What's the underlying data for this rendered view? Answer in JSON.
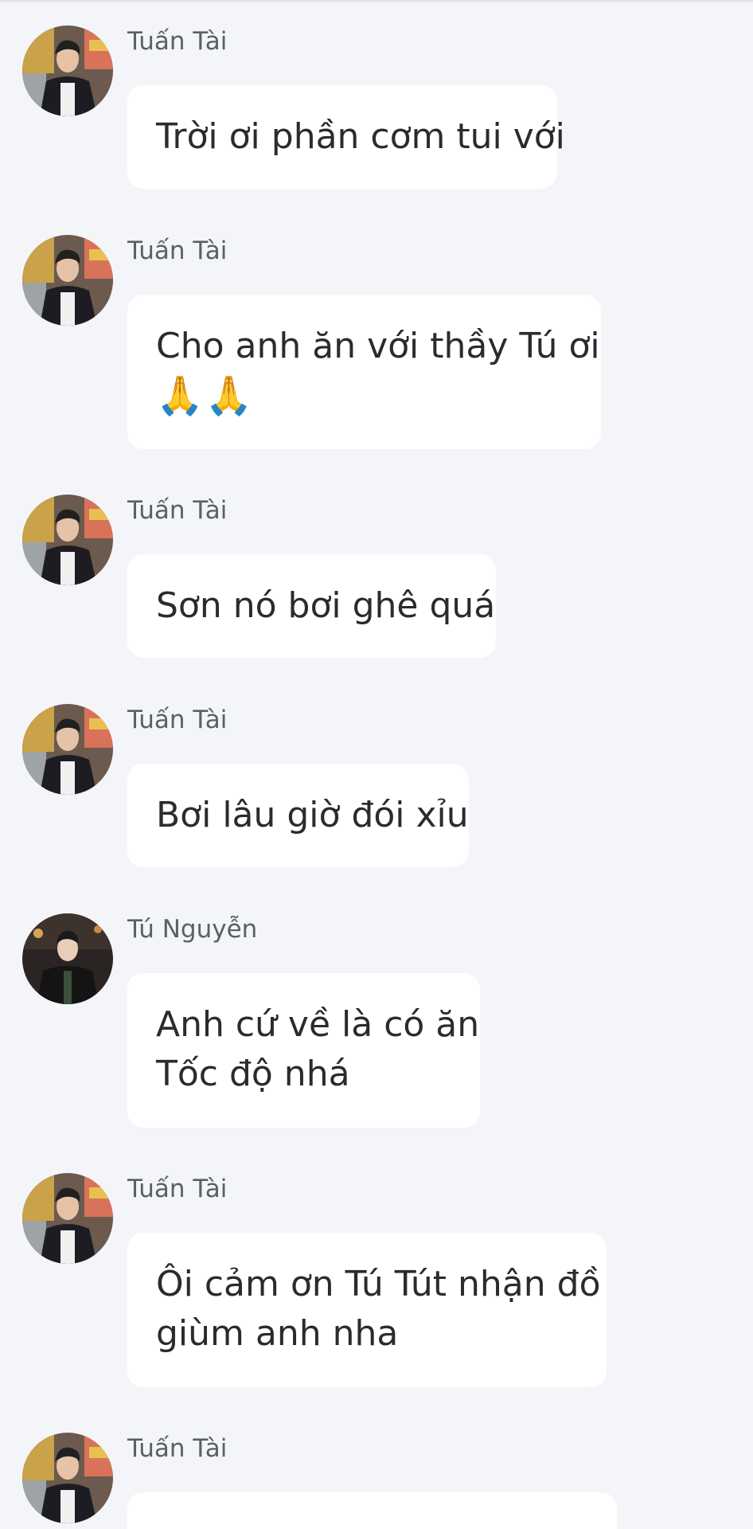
{
  "messages": [
    {
      "sender": "Tuấn Tài",
      "avatar": "tuan-tai",
      "lines": [
        "Trời ơi phần cơm tui với"
      ]
    },
    {
      "sender": "Tuấn Tài",
      "avatar": "tuan-tai",
      "lines": [
        "Cho anh ăn với thầy Tú ơi",
        "🙏🙏"
      ]
    },
    {
      "sender": "Tuấn Tài",
      "avatar": "tuan-tai",
      "lines": [
        "Sơn nó bơi ghê quá"
      ]
    },
    {
      "sender": "Tuấn Tài",
      "avatar": "tuan-tai",
      "lines": [
        "Bơi lâu giờ đói xỉu"
      ]
    },
    {
      "sender": "Tú Nguyễn",
      "avatar": "tu-nguyen",
      "lines": [
        "Anh cứ về là có ăn",
        "Tốc độ nhá"
      ]
    },
    {
      "sender": "Tuấn Tài",
      "avatar": "tuan-tai",
      "lines": [
        "Ôi cảm ơn Tú Tút nhận đồ",
        "giùm anh nha"
      ]
    },
    {
      "sender": "Tuấn Tài",
      "avatar": "tuan-tai",
      "lines": [
        ""
      ]
    }
  ],
  "colors": {
    "background": "#f4f5f9",
    "bubble": "#ffffff",
    "sender_text": "#5b5f66",
    "message_text": "#2b2b2f"
  }
}
